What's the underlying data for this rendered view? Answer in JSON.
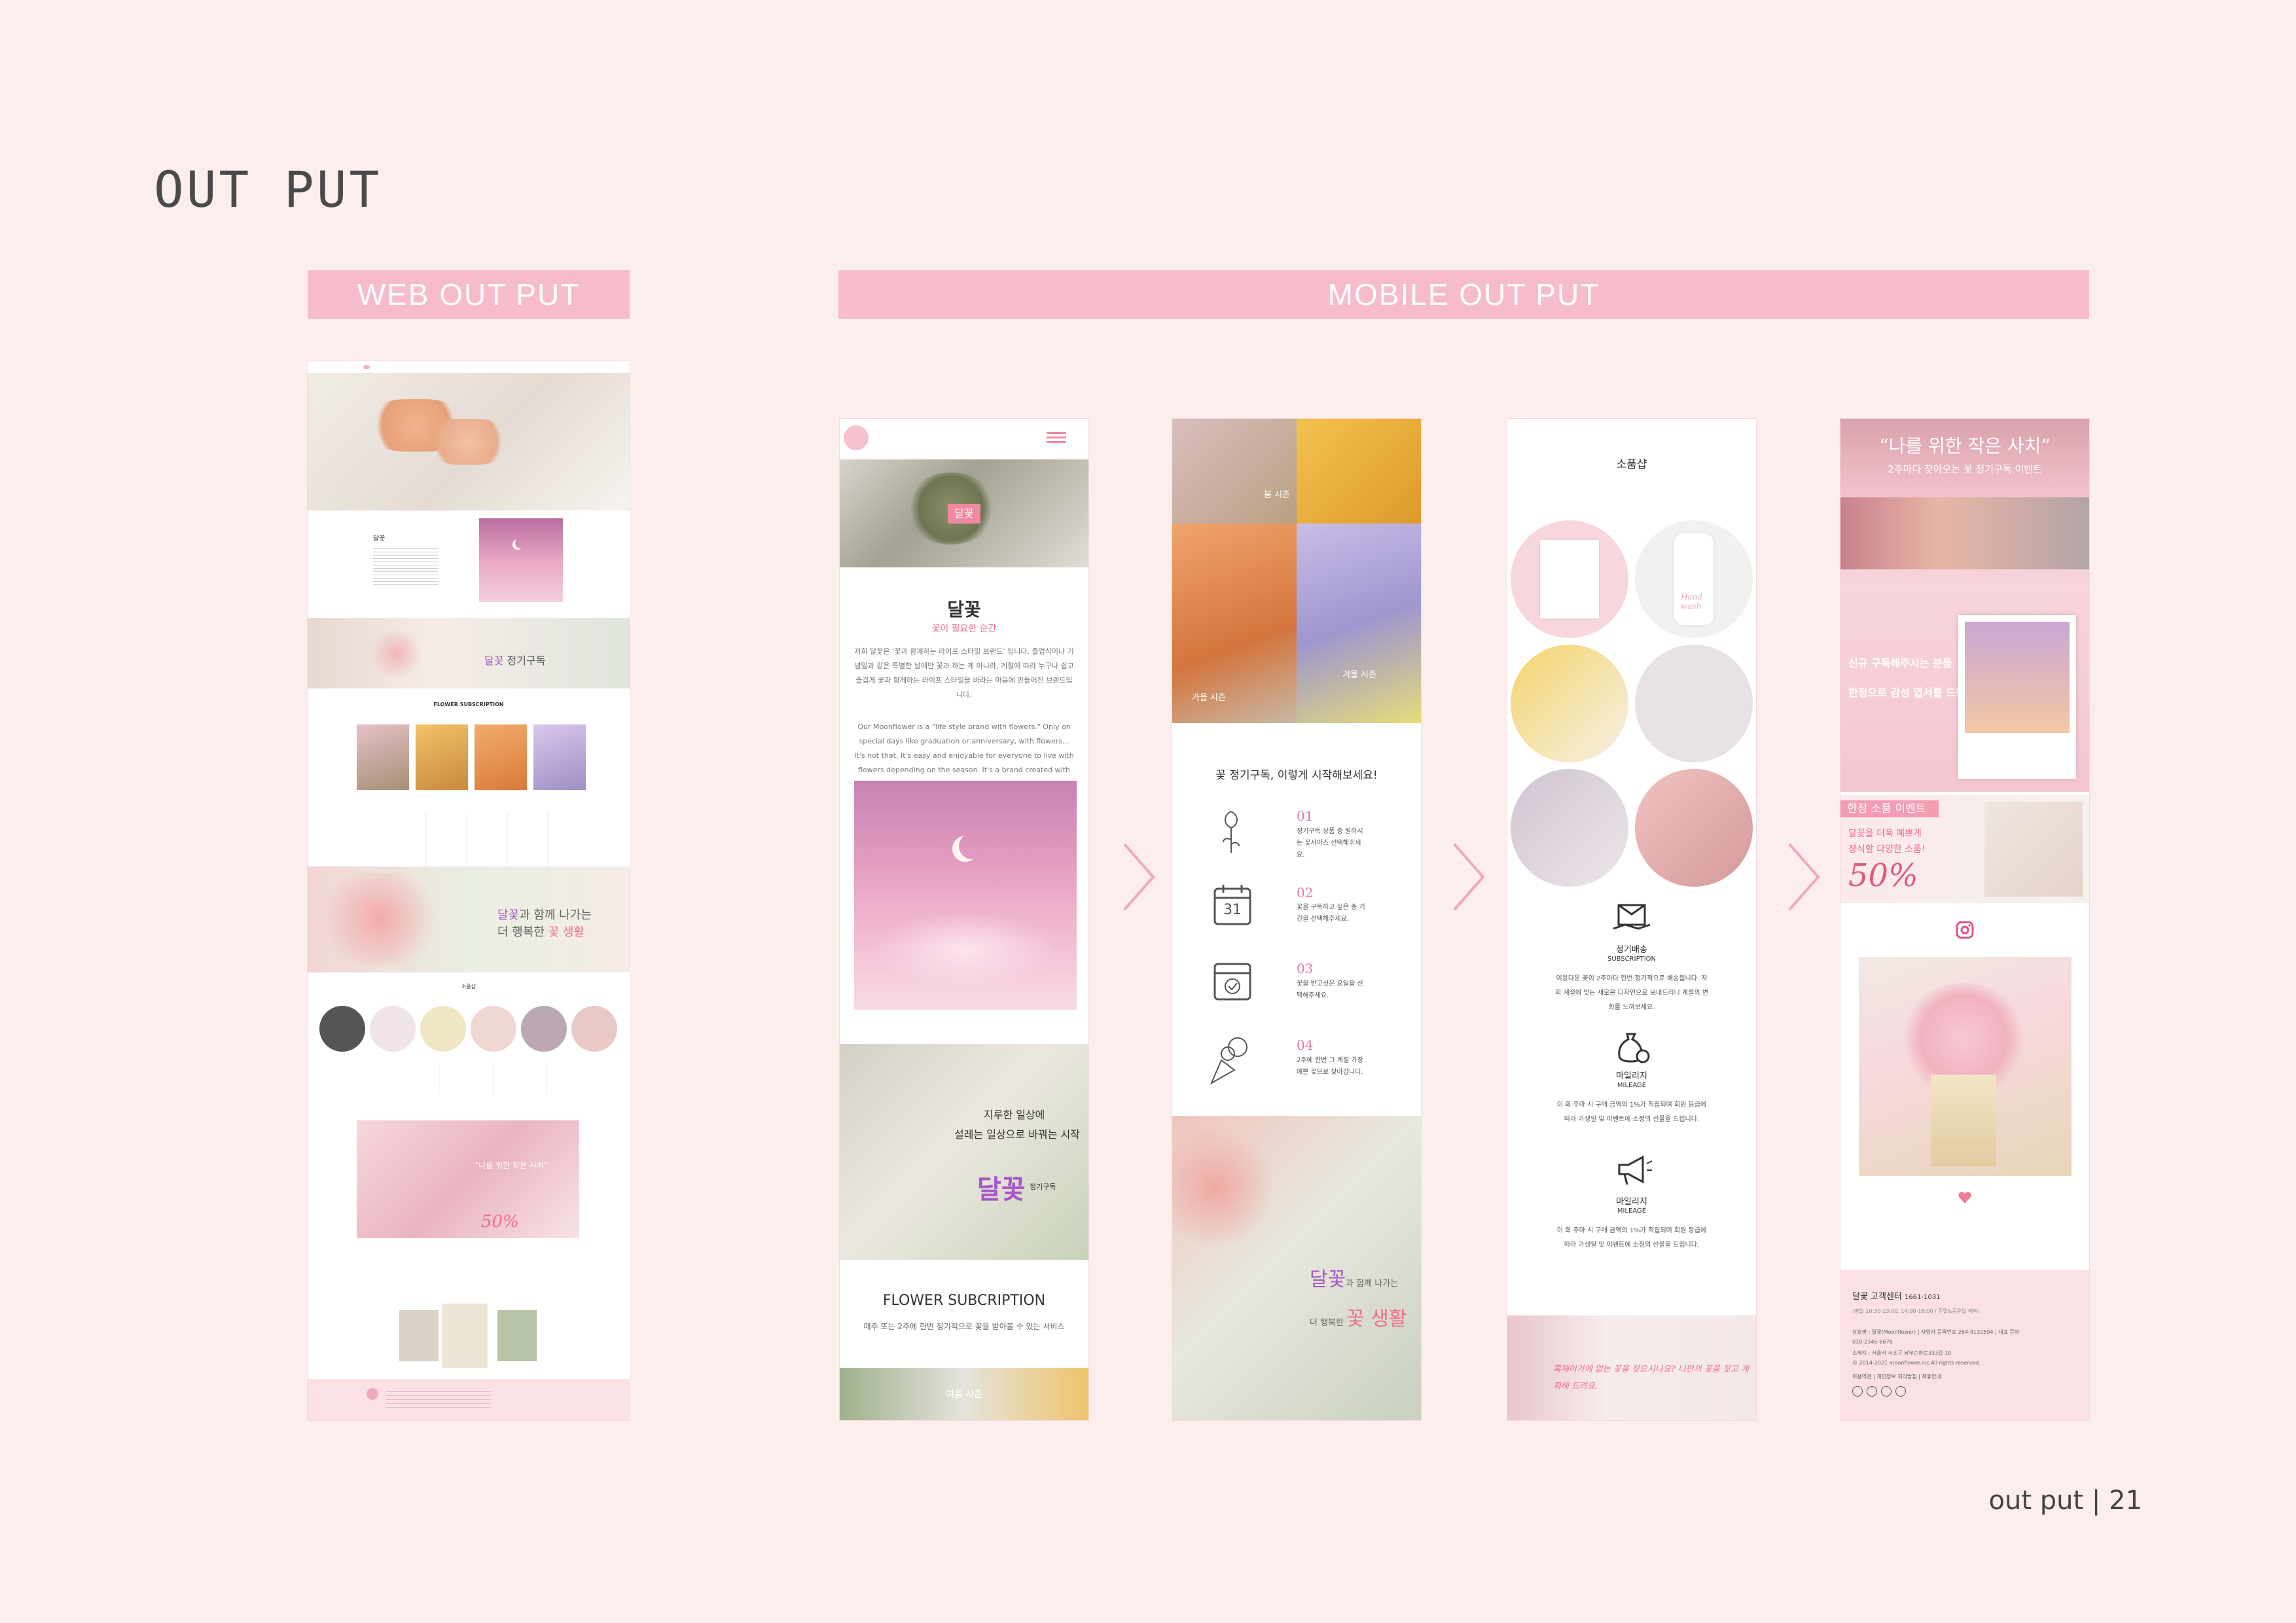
{
  "page": {
    "title": "OUT PUT",
    "footer": "out put | 21"
  },
  "sections": {
    "web_label": "WEB OUT PUT",
    "mobile_label": "MOBILE OUT PUT"
  },
  "web": {
    "brand_small": "달꽃",
    "subscription_heading": "FLOWER SUBSCRIPTION",
    "banner_brand": "달꽃",
    "banner_rest": "정기구독",
    "banner_line1_a": "달꽃",
    "banner_line1_b": "과 함께 나가는",
    "banner_line2_a": "더 행복한 ",
    "banner_line2_b": "꽃 생활",
    "shop_heading": "소품샵",
    "event_quote": "“나를 위한 작은 사치”",
    "event_percent": "50%"
  },
  "mobile1": {
    "hero_badge": "달꽃",
    "brand": "달꽃",
    "tagline": "꽃이 필요한 순간",
    "para_ko": "저희 달꽃은 ‘꽃과 함께하는 라이프 스타일 브랜드’ 입니다. 졸업식이나 기념일과 같은 특별한 날에만 꽃과 하는 게 아니라, 계절에 따라 누구나 쉽고 즐겁게 꽃과 함께하는 라이프 스타일을 바라는 마음에 만들어진 브랜드입니다.",
    "para_en": "Our Moonflower is a \"life style brand with flowers.\" Only on special days like graduation or anniversary, with flowers... It's not that. It's easy and enjoyable for everyone to live with flowers depending on the season. It's a brand created with the desire for style.",
    "promo_line1": "지루한 일상에",
    "promo_line2": "설레는 일상으로 바꿔는 시작",
    "promo_brand": "달꽃",
    "promo_sub": "정기구독",
    "subscription_title": "FLOWER SUBCRIPTION",
    "subscription_desc": "매주 또는 2주에 한번 정기적으로 꽃을 받아볼 수 있는 서비스",
    "bottom_tag": "여름 시즌"
  },
  "mobile2": {
    "tag_spring": "봄 시즌",
    "tag_autumn": "가을 시즌",
    "tag_winter": "겨울 시즌",
    "heading": "꽃 정기구독, 이렇게 시작해보세요!",
    "steps": [
      {
        "num": "01",
        "text": "정기구독 상품 중 원하시는 꽃사이즈 선택해주세요."
      },
      {
        "num": "02",
        "text": "꽃을 구독하고 싶은 총 기간을 선택해주세요."
      },
      {
        "num": "03",
        "text": "꽃을 받고싶은 요일을 선택해주세요."
      },
      {
        "num": "04",
        "text": "2주에 한번 그 계절 가장 예쁜 꽃으로 찾아갑니다."
      }
    ],
    "calendar_num": "31",
    "closing_a": "달꽃",
    "closing_b": "과 함께 나가는",
    "closing_c": "더 행복한 ",
    "closing_d": "꽃 생활"
  },
  "mobile3": {
    "heading": "소품샵",
    "handwash": "Hand wash",
    "features": [
      {
        "title": "정기배송",
        "en": "SUBSCRIPTION",
        "desc": "이용다운 꽃이 2주마다 한번 정기적으로 배송됩니다. 저희 계절에 맞는 새로운 디자인으로 보내드리니 계절의 변화를 느껴보세요."
      },
      {
        "title": "마일리지",
        "en": "MILEAGE",
        "desc": "이 회 주마 시 구매 금액의 1%가 적립되며 회원 등급에 따라 가생일 및 이벤트에 소정의 선물을 드립니다."
      },
      {
        "title": "마일리지",
        "en": "MILEAGE",
        "desc": "이 회 주마 시 구매 금액의 1%가 적립되며 회원 등급에 따라 가생일 및 이벤트에 소정의 선물을 드립니다."
      }
    ],
    "banner_text": "혹재이가에 없는 꽃을 찾으시나요? 나만의 꽃을 찾고 계획해 드려요."
  },
  "mobile4": {
    "quote": "“나를 위한 작은 사치”",
    "sub": "2주마다 찾아오는 꽃 정기구독 이벤트",
    "offer1": "신규 구독해주시는 분들",
    "offer2": "한정으로 감성 엽서를 드립니다.",
    "limited_tag": "한정 소품 이벤트",
    "limited_line1": "달꽃을 더욱 예쁘게",
    "limited_line2": "장식할 다양한 소품!",
    "limited_percent": "50%",
    "cs_title": "달꽃 고객센터",
    "cs_phone": "1661-1031",
    "cs_hours": "(평일 10:30-13:00, 14:00-18:00 / 주말&공휴일 제외)",
    "info1": "상호명 : 달꽃(Moonflower) | 사업자 등록번호 264-9132594 | 대표 문의",
    "info2": "010-2345-6678",
    "info3": "소재지 : 서울시 서초구 남부순환로333길 10",
    "info4": "© 2014-2021 moonflower.inc.All rights reserved.",
    "info5": "이용약관 | 개인정보 처리방침 | 제휴안내"
  },
  "colors": {
    "background": "#fdeeee",
    "band": "#f6bccb",
    "accent_pink": "#ee6f8c",
    "accent_purple": "#a855c9"
  }
}
